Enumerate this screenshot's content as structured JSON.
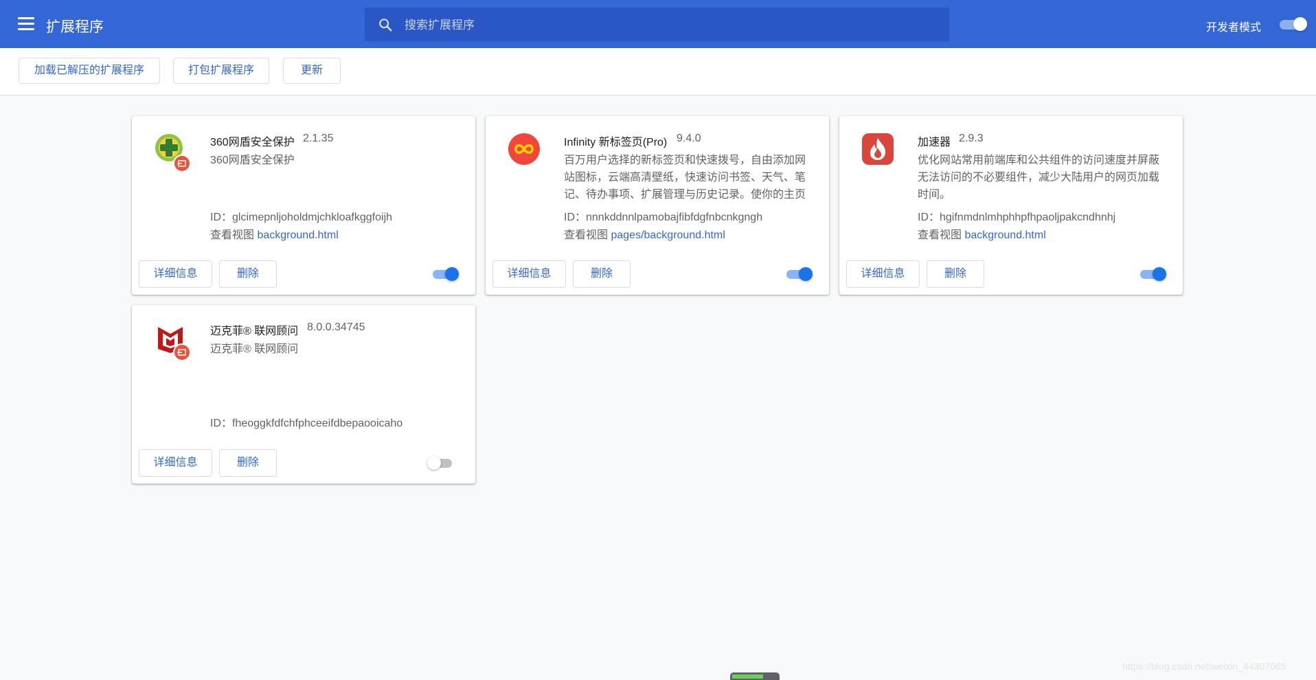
{
  "header": {
    "title": "扩展程序",
    "search_placeholder": "搜索扩展程序",
    "developer_mode_label": "开发者模式",
    "developer_mode_on": true
  },
  "toolbar": {
    "load_unpacked": "加载已解压的扩展程序",
    "pack": "打包扩展程序",
    "update": "更新"
  },
  "buttons": {
    "details": "详细信息",
    "remove": "删除"
  },
  "extensions": [
    {
      "name": "360网盾安全保护",
      "version": "2.1.35",
      "description": "360网盾安全保护",
      "id": "ID：glcimepnljoholdmjchkloafkggfoijh",
      "views_label": "查看视图",
      "view_link": "background.html",
      "enabled": true,
      "icon": "360-shield-icon"
    },
    {
      "name": "Infinity 新标签页(Pro)",
      "version": "9.4.0",
      "description": "百万用户选择的新标签页和快速拨号，自由添加网站图标，云端高清壁纸，快速访问书签、天气、笔记、待办事项、扩展管理与历史记录。使你的主页",
      "id": "ID：nnnkddnnlpamobajfibfdgfnbcnkgngh",
      "views_label": "查看视图",
      "view_link": "pages/background.html",
      "enabled": true,
      "icon": "infinity-icon"
    },
    {
      "name": "加速器",
      "version": "2.9.3",
      "description": "优化网站常用前端库和公共组件的访问速度并屏蔽无法访问的不必要组件，减少大陆用户的网页加载时间。",
      "id": "ID：hgifnmdnlmhphhpfhpaoljpakcndhnhj",
      "views_label": "查看视图",
      "view_link": "background.html",
      "enabled": true,
      "icon": "flame-icon"
    },
    {
      "name": "迈克菲® 联网顾问",
      "version": "8.0.0.34745",
      "description": "迈克菲® 联网顾问",
      "id": "ID：fheoggkfdfchfphceeifdbepaooicaho",
      "enabled": false,
      "icon": "mcafee-icon"
    }
  ],
  "watermark": "https://blog.csdn.net/weixin_44307065",
  "colors": {
    "header": "#3367d6",
    "search": "#2a56c6",
    "accent": "#1a73e8",
    "link": "#3367d6"
  }
}
